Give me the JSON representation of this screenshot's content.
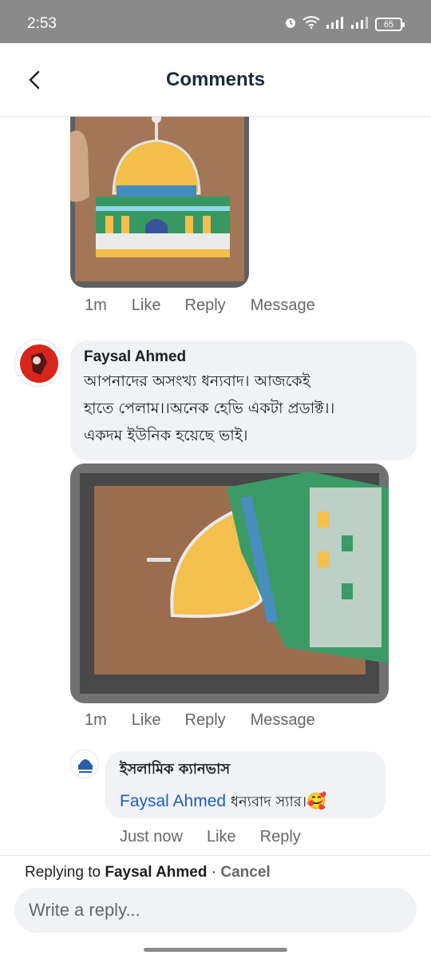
{
  "status_bar": {
    "time": "2:53",
    "battery": "65",
    "icons": [
      "alarm-icon",
      "wifi-icon",
      "signal-icon",
      "signal-icon",
      "battery-icon"
    ]
  },
  "header": {
    "title": "Comments",
    "back_icon": "chevron-left-icon"
  },
  "comments": [
    {
      "kind": "photo-only",
      "actions": {
        "time": "1m",
        "like": "Like",
        "reply": "Reply",
        "message": "Message"
      }
    },
    {
      "author": "Faysal Ahmed",
      "text": "আপনাদের অসংখ্য ধন্যবাদ। আজকেই হাতে পেলাম।।অনেক হেভি একটা প্রডাক্ট।। একদম ইউনিক হয়েছে ভাই।",
      "text_lines": [
        "আপনাদের অসংখ্য ধন্যবাদ। আজকেই",
        "হাতে পেলাম।।অনেক হেভি একটা প্রডাক্ট।।",
        "একদম ইউনিক হয়েছে ভাই।"
      ],
      "actions": {
        "time": "1m",
        "like": "Like",
        "reply": "Reply",
        "message": "Message"
      }
    },
    {
      "author": "ইসলামিক ক্যানভাস",
      "mention": "Faysal Ahmed",
      "text": "ধন্যবাদ স্যার।",
      "emoji": "🥰",
      "actions": {
        "time": "Just now",
        "like": "Like",
        "reply": "Reply"
      }
    }
  ],
  "footer": {
    "replying_prefix": "Replying to ",
    "replying_name": "Faysal Ahmed",
    "separator": " · ",
    "cancel": "Cancel",
    "placeholder": "Write a reply..."
  }
}
